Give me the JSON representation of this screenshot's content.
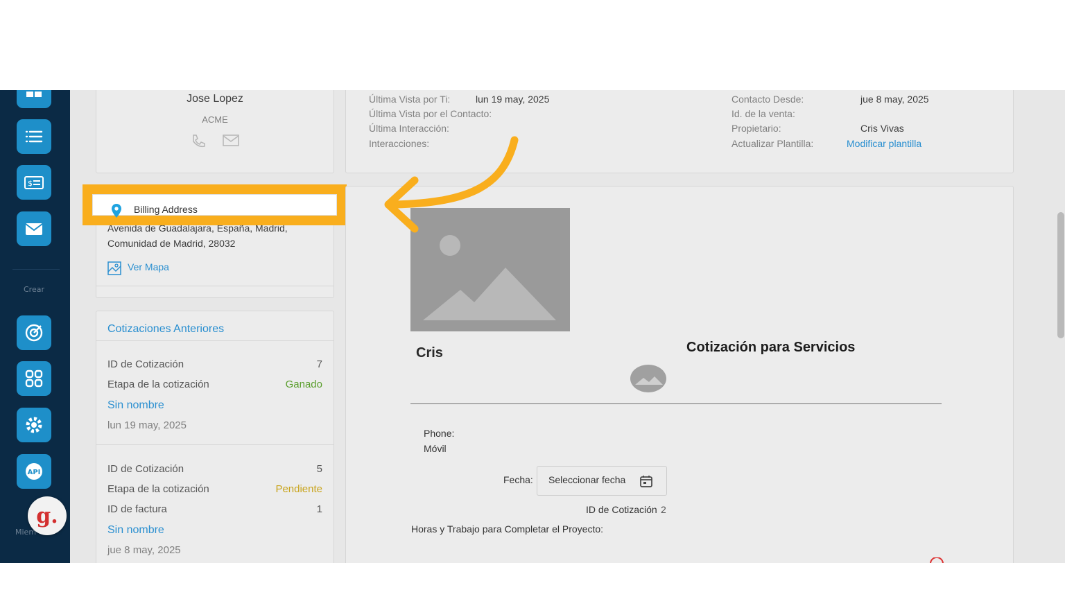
{
  "contact": {
    "name": "Jose Lopez",
    "company": "ACME",
    "phone_icon": "phone-icon",
    "mail_icon": "mail-icon"
  },
  "info": {
    "left": [
      {
        "label": "Última Vista por Ti:",
        "value": "lun 19 may, 2025"
      },
      {
        "label": "Última Vista por el Contacto:",
        "value": ""
      },
      {
        "label": "Última Interacción:",
        "value": ""
      },
      {
        "label": "Interacciones:",
        "value": ""
      }
    ],
    "right": [
      {
        "label": "Contacto Desde:",
        "value": "jue 8 may, 2025"
      },
      {
        "label": "Id. de la venta:",
        "value": ""
      },
      {
        "label": "Propietario:",
        "value": "Cris Vivas"
      },
      {
        "label": "Actualizar Plantilla:",
        "value": "Modificar plantilla"
      }
    ]
  },
  "billing": {
    "title": "Billing Address",
    "address_line1": "Avenida de Guadalajara, España, Madrid,",
    "address_line2": "Comunidad de Madrid, 28032",
    "map_link": "Ver Mapa"
  },
  "quotes": {
    "title": "Cotizaciones Anteriores",
    "items": [
      {
        "id_label": "ID de Cotización",
        "id_value": "7",
        "stage_label": "Etapa de la cotización",
        "stage_value": "Ganado",
        "name": "Sin nombre",
        "date": "lun 19 may, 2025"
      },
      {
        "id_label": "ID de Cotización",
        "id_value": "5",
        "stage_label": "Etapa de la cotización",
        "stage_value": "Pendiente",
        "invoice_label": "ID de factura",
        "invoice_value": "1",
        "name": "Sin nombre",
        "date": "jue 8 may, 2025"
      }
    ]
  },
  "document": {
    "company_name": "Cris",
    "title": "Cotización para Servicios",
    "phone_label": "Phone:",
    "mobile_label": "Móvil",
    "date_label": "Fecha:",
    "date_button": "Seleccionar fecha",
    "quote_id_label": "ID de Cotización",
    "quote_id_value": "2",
    "hours_label": "Horas y Trabajo para Completar el Proyecto:"
  },
  "sidebar": {
    "create_label": "Crear",
    "members_label": "Miem",
    "logo_letter": "g.",
    "api_label": "API"
  },
  "colors": {
    "highlight": "#f9ae1d",
    "sidebar": "#0b2a45",
    "sidebar_button": "#1e8fc9",
    "link": "#2a8fd0",
    "won": "#5a9e2c",
    "pending": "#c9a41c"
  }
}
